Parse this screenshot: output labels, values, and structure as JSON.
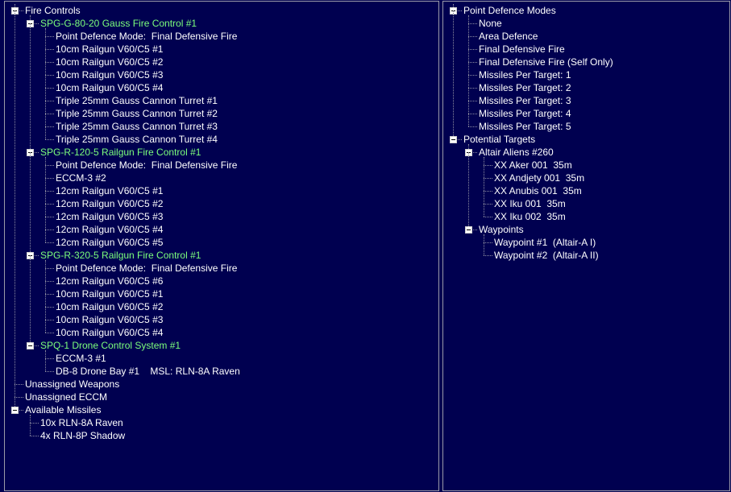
{
  "left_tree": [
    {
      "text": "Fire Controls",
      "level": 0,
      "toggle": true,
      "name": "tree-item-fire-controls"
    },
    {
      "text": "SPG-G-80-20 Gauss Fire Control #1",
      "level": 1,
      "toggle": true,
      "fc": true,
      "name": "tree-item-fire-control"
    },
    {
      "text": "Point Defence Mode:  Final Defensive Fire",
      "level": 2,
      "name": "tree-item-pd-mode"
    },
    {
      "text": "10cm Railgun V60/C5 #1",
      "level": 2,
      "name": "tree-item-weapon"
    },
    {
      "text": "10cm Railgun V60/C5 #2",
      "level": 2,
      "name": "tree-item-weapon"
    },
    {
      "text": "10cm Railgun V60/C5 #3",
      "level": 2,
      "name": "tree-item-weapon"
    },
    {
      "text": "10cm Railgun V60/C5 #4",
      "level": 2,
      "name": "tree-item-weapon"
    },
    {
      "text": "Triple 25mm Gauss Cannon Turret #1",
      "level": 2,
      "name": "tree-item-weapon"
    },
    {
      "text": "Triple 25mm Gauss Cannon Turret #2",
      "level": 2,
      "name": "tree-item-weapon"
    },
    {
      "text": "Triple 25mm Gauss Cannon Turret #3",
      "level": 2,
      "name": "tree-item-weapon"
    },
    {
      "text": "Triple 25mm Gauss Cannon Turret #4",
      "level": 2,
      "name": "tree-item-weapon"
    },
    {
      "text": "SPG-R-120-5 Railgun Fire Control #1",
      "level": 1,
      "toggle": true,
      "fc": true,
      "name": "tree-item-fire-control"
    },
    {
      "text": "Point Defence Mode:  Final Defensive Fire",
      "level": 2,
      "name": "tree-item-pd-mode"
    },
    {
      "text": "ECCM-3 #2",
      "level": 2,
      "name": "tree-item-eccm"
    },
    {
      "text": "12cm Railgun V60/C5 #1",
      "level": 2,
      "name": "tree-item-weapon"
    },
    {
      "text": "12cm Railgun V60/C5 #2",
      "level": 2,
      "name": "tree-item-weapon"
    },
    {
      "text": "12cm Railgun V60/C5 #3",
      "level": 2,
      "name": "tree-item-weapon"
    },
    {
      "text": "12cm Railgun V60/C5 #4",
      "level": 2,
      "name": "tree-item-weapon"
    },
    {
      "text": "12cm Railgun V60/C5 #5",
      "level": 2,
      "name": "tree-item-weapon"
    },
    {
      "text": "SPG-R-320-5 Railgun Fire Control #1",
      "level": 1,
      "toggle": true,
      "fc": true,
      "name": "tree-item-fire-control"
    },
    {
      "text": "Point Defence Mode:  Final Defensive Fire",
      "level": 2,
      "name": "tree-item-pd-mode"
    },
    {
      "text": "12cm Railgun V60/C5 #6",
      "level": 2,
      "name": "tree-item-weapon"
    },
    {
      "text": "10cm Railgun V60/C5 #1",
      "level": 2,
      "name": "tree-item-weapon"
    },
    {
      "text": "10cm Railgun V60/C5 #2",
      "level": 2,
      "name": "tree-item-weapon"
    },
    {
      "text": "10cm Railgun V60/C5 #3",
      "level": 2,
      "name": "tree-item-weapon"
    },
    {
      "text": "10cm Railgun V60/C5 #4",
      "level": 2,
      "name": "tree-item-weapon"
    },
    {
      "text": "SPQ-1 Drone Control System #1",
      "level": 1,
      "toggle": true,
      "fc": true,
      "name": "tree-item-fire-control"
    },
    {
      "text": "ECCM-3 #1",
      "level": 2,
      "name": "tree-item-eccm"
    },
    {
      "text": "DB-8 Drone Bay #1    MSL: RLN-8A Raven",
      "level": 2,
      "name": "tree-item-drone-bay"
    },
    {
      "text": "Unassigned Weapons",
      "level": 0,
      "name": "tree-item-unassigned-weapons"
    },
    {
      "text": "Unassigned ECCM",
      "level": 0,
      "name": "tree-item-unassigned-eccm"
    },
    {
      "text": "Available Missiles",
      "level": 0,
      "toggle": true,
      "name": "tree-item-available-missiles"
    },
    {
      "text": "10x RLN-8A Raven",
      "level": 1,
      "name": "tree-item-missile"
    },
    {
      "text": "4x RLN-8P Shadow",
      "level": 1,
      "name": "tree-item-missile"
    }
  ],
  "right_tree": [
    {
      "text": "Point Defence Modes",
      "level": 0,
      "toggle": true,
      "name": "tree-item-pd-modes"
    },
    {
      "text": "None",
      "level": 1,
      "name": "tree-item-pd-option"
    },
    {
      "text": "Area Defence",
      "level": 1,
      "name": "tree-item-pd-option"
    },
    {
      "text": "Final Defensive Fire",
      "level": 1,
      "name": "tree-item-pd-option"
    },
    {
      "text": "Final Defensive Fire (Self Only)",
      "level": 1,
      "name": "tree-item-pd-option"
    },
    {
      "text": "Missiles Per Target: 1",
      "level": 1,
      "name": "tree-item-pd-option"
    },
    {
      "text": "Missiles Per Target: 2",
      "level": 1,
      "name": "tree-item-pd-option"
    },
    {
      "text": "Missiles Per Target: 3",
      "level": 1,
      "name": "tree-item-pd-option"
    },
    {
      "text": "Missiles Per Target: 4",
      "level": 1,
      "name": "tree-item-pd-option"
    },
    {
      "text": "Missiles Per Target: 5",
      "level": 1,
      "name": "tree-item-pd-option"
    },
    {
      "text": "Potential Targets",
      "level": 0,
      "toggle": true,
      "name": "tree-item-potential-targets"
    },
    {
      "text": "Altair Aliens #260",
      "level": 1,
      "toggle": true,
      "name": "tree-item-alien-group"
    },
    {
      "text": "XX Aker 001  35m",
      "level": 2,
      "name": "tree-item-target"
    },
    {
      "text": "XX Andjety 001  35m",
      "level": 2,
      "name": "tree-item-target"
    },
    {
      "text": "XX Anubis 001  35m",
      "level": 2,
      "name": "tree-item-target"
    },
    {
      "text": "XX Iku 001  35m",
      "level": 2,
      "name": "tree-item-target"
    },
    {
      "text": "XX Iku 002  35m",
      "level": 2,
      "name": "tree-item-target"
    },
    {
      "text": "Waypoints",
      "level": 1,
      "toggle": true,
      "name": "tree-item-waypoints"
    },
    {
      "text": "Waypoint #1  (Altair-A I)",
      "level": 2,
      "name": "tree-item-waypoint"
    },
    {
      "text": "Waypoint #2  (Altair-A II)",
      "level": 2,
      "name": "tree-item-waypoint"
    }
  ]
}
